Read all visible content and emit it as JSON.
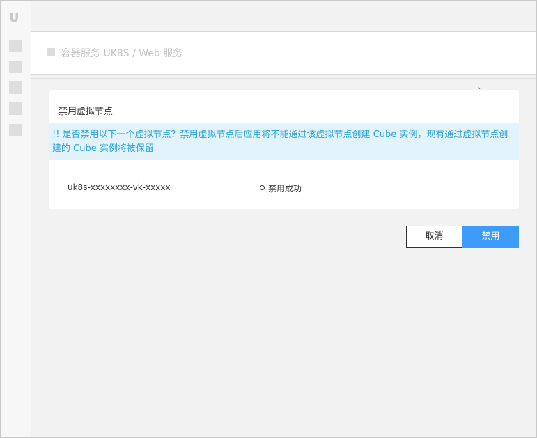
{
  "sidebar": {
    "logo": "U",
    "icons": [
      "menu-icon-1",
      "menu-icon-2",
      "menu-icon-3",
      "menu-icon-4",
      "menu-icon-5"
    ]
  },
  "header": {
    "title": "容器服务 UK8S / Web 服务"
  },
  "modal": {
    "close_glyph": "ˋ",
    "title": "禁用虚拟节点",
    "alert": "!! 是否禁用以下一个虚拟节点？禁用虚拟节点后应用将不能通过该虚拟节点创建 Cube 实例，现有通过虚拟节点创建的 Cube 实例将被保留",
    "node": {
      "name": "uk8s-xxxxxxxx-vk-xxxxx",
      "status": "禁用成功"
    }
  },
  "actions": {
    "cancel_label": "取消",
    "disable_label": "禁用"
  },
  "colors": {
    "primary": "#3d9bfa",
    "alert_text": "#2aa3d8",
    "alert_bg": "#e3f3fb"
  }
}
